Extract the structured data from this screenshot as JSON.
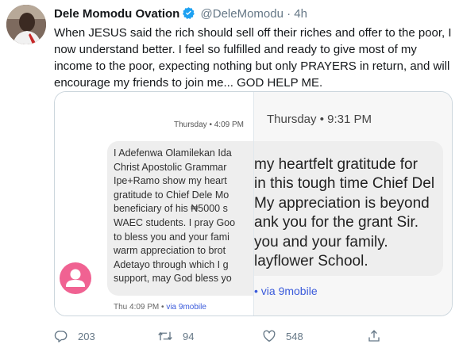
{
  "user": {
    "display_name": "Dele Momodu Ovation",
    "handle": "@DeleMomodu",
    "separator": "·",
    "time": "4h"
  },
  "tweet": {
    "text": "When JESUS said the rich should sell off their riches and offer to the poor, I now understand better. I feel so fulfilled and ready to give most of my income to the poor, expecting nothing but only PRAYERS in return, and will encourage my friends to join me... GOD HELP ME."
  },
  "media": {
    "left": {
      "timestamp": "Thursday • 4:09 PM",
      "message_lines": [
        "I Adefenwa Olamilekan Ida",
        "Christ Apostolic Grammar",
        "Ipe+Ramo show my heart",
        "gratitude to Chief Dele Mo",
        "beneficiary of his ₦5000 s",
        "WAEC students. I pray Goo",
        "to bless you and your fami",
        "warm appreciation to brot",
        "Adetayo through which I g",
        "support, may God bless yo"
      ],
      "footer_time": "Thu 4:09 PM",
      "footer_sep": " • ",
      "footer_net": "via 9mobile"
    },
    "right": {
      "timestamp": "Thursday • 9:31 PM",
      "message_lines": [
        "my heartfelt gratitude for",
        "in this tough time Chief Del",
        "My appreciation is beyond",
        "ank you for the grant Sir.",
        "you and your family.",
        "layflower School."
      ],
      "footer": "• via 9mobile"
    }
  },
  "actions": {
    "replies": "203",
    "retweets": "94",
    "likes": "548"
  },
  "colors": {
    "text": "#14171a",
    "muted": "#657786",
    "verified": "#1da1f2",
    "network_link": "#3b5bdb",
    "sms_avatar": "#f06292"
  }
}
